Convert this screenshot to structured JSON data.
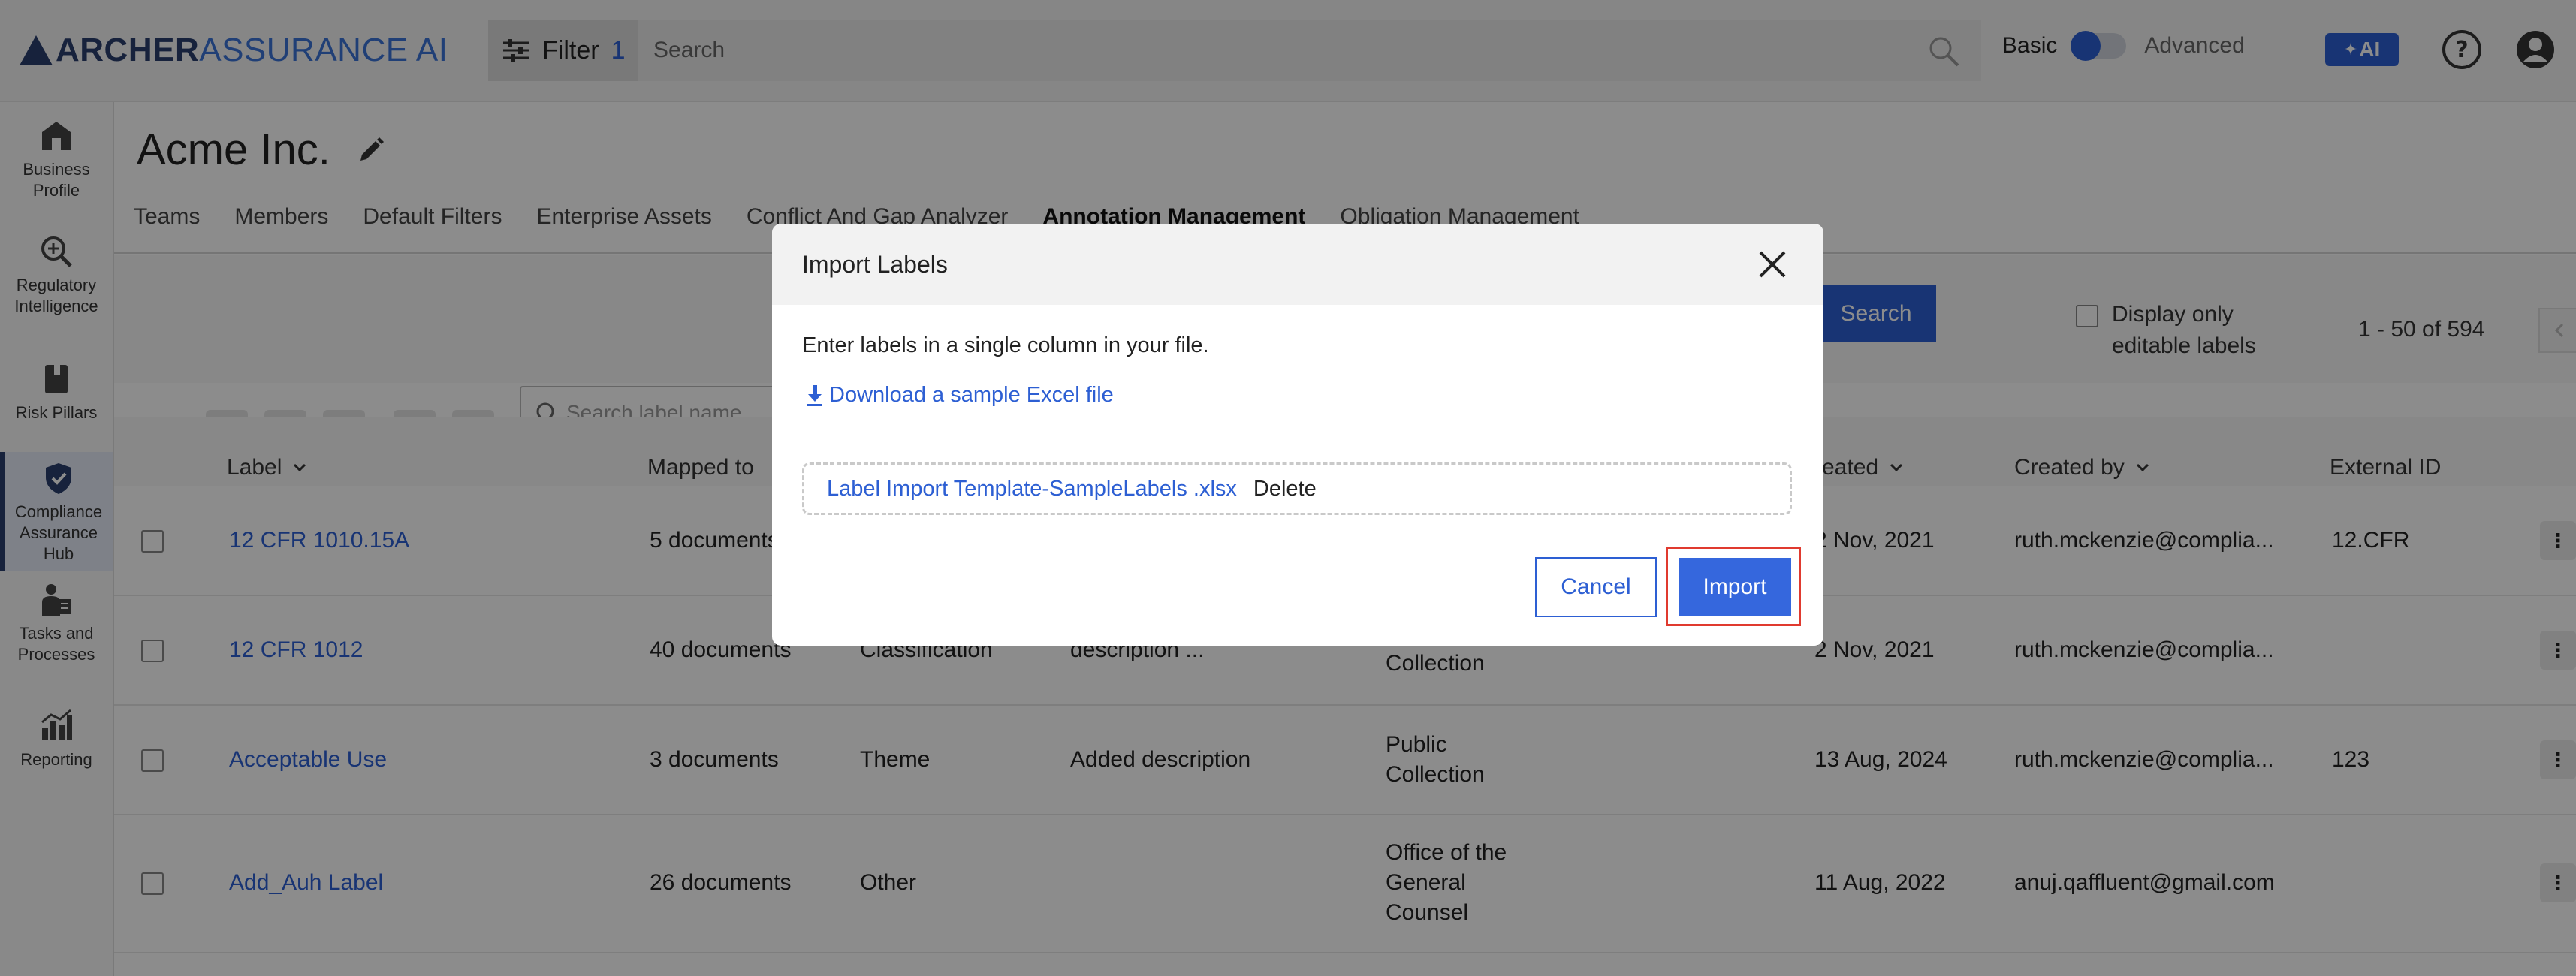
{
  "app": {
    "logo_part1": "ARCHER",
    "logo_part2": "ASSURANCE AI",
    "filter_label": "Filter",
    "filter_count": "1",
    "search_placeholder": "Search",
    "mode_basic": "Basic",
    "mode_advanced": "Advanced",
    "ai_label": "AI"
  },
  "sidebar": {
    "items": [
      {
        "label": "Business Profile",
        "icon": "building-icon"
      },
      {
        "label": "Regulatory Intelligence",
        "icon": "magnifier-plus-icon"
      },
      {
        "label": "Risk Pillars",
        "icon": "book-icon"
      },
      {
        "label": "Compliance Assurance Hub",
        "icon": "shield-check-icon"
      },
      {
        "label": "Tasks and Processes",
        "icon": "person-tasks-icon"
      },
      {
        "label": "Reporting",
        "icon": "bar-chart-icon"
      }
    ]
  },
  "page": {
    "title": "Acme Inc.",
    "tabs": [
      "Teams",
      "Members",
      "Default Filters",
      "Enterprise Assets",
      "Conflict And Gap Analyzer",
      "Annotation Management",
      "Obligation Management"
    ]
  },
  "toolbar": {
    "label_search_placeholder": "Search label name",
    "search_button": "Search",
    "editable_label": "Display only editable labels",
    "pager": "1 - 50 of 594"
  },
  "table": {
    "headers": [
      "Label",
      "Mapped to",
      "reated",
      "Created by",
      "External ID"
    ],
    "rows": [
      {
        "label": "12 CFR 1010.15A",
        "mapped": "5 documents",
        "type": "",
        "desc": "",
        "collection": "",
        "created": "2 Nov, 2021",
        "by": "ruth.mckenzie@complia...",
        "ext": "12.CFR"
      },
      {
        "label": "12 CFR 1012",
        "mapped": "40 documents",
        "type": "Classification",
        "desc": "description ...",
        "collection": "Collection",
        "created": "2 Nov, 2021",
        "by": "ruth.mckenzie@complia...",
        "ext": ""
      },
      {
        "label": "Acceptable Use",
        "mapped": "3 documents",
        "type": "Theme",
        "desc": "Added description",
        "collection": "Public Collection",
        "created": "13 Aug, 2024",
        "by": "ruth.mckenzie@complia...",
        "ext": "123"
      },
      {
        "label": "Add_Auh Label",
        "mapped": "26 documents",
        "type": "Other",
        "desc": "",
        "collection": "Office of the General Counsel",
        "created": "11 Aug, 2022",
        "by": "anuj.qaffluent@gmail.com",
        "ext": ""
      }
    ]
  },
  "modal": {
    "title": "Import Labels",
    "instruction": "Enter labels in a single column in your file.",
    "download_link": "Download a sample Excel file",
    "file_name": "Label Import Template-SampleLabels .xlsx",
    "delete_label": "Delete",
    "cancel_label": "Cancel",
    "import_label": "Import"
  },
  "colors": {
    "accent": "#2d5fd3",
    "highlight": "#e03a2f",
    "brand_dark": "#2a3f6e"
  }
}
